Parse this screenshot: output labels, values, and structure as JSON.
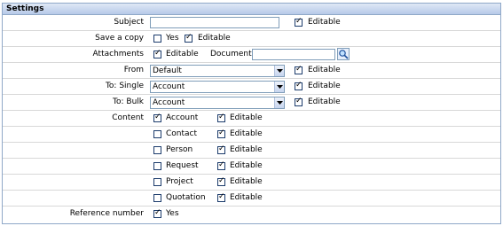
{
  "panel": {
    "title": "Settings"
  },
  "rows": {
    "subject": {
      "label": "Subject",
      "value": "",
      "editable_checked": true,
      "editable_label": "Editable"
    },
    "save_copy": {
      "label": "Save a copy",
      "yes_checked": false,
      "yes_label": "Yes",
      "editable_checked": true,
      "editable_label": "Editable"
    },
    "attachments": {
      "label": "Attachments",
      "editable_checked": true,
      "editable_label": "Editable",
      "document_label": "Document",
      "document_value": ""
    },
    "from": {
      "label": "From",
      "value": "Default",
      "editable_checked": true,
      "editable_label": "Editable"
    },
    "to_single": {
      "label": "To: Single",
      "value": "Account",
      "editable_checked": true,
      "editable_label": "Editable"
    },
    "to_bulk": {
      "label": "To: Bulk",
      "value": "Account",
      "editable_checked": true,
      "editable_label": "Editable"
    },
    "content": {
      "label": "Content",
      "items": [
        {
          "label": "Account",
          "checked": true,
          "editable_checked": true,
          "editable_label": "Editable"
        },
        {
          "label": "Contact",
          "checked": false,
          "editable_checked": true,
          "editable_label": "Editable"
        },
        {
          "label": "Person",
          "checked": false,
          "editable_checked": true,
          "editable_label": "Editable"
        },
        {
          "label": "Request",
          "checked": false,
          "editable_checked": true,
          "editable_label": "Editable"
        },
        {
          "label": "Project",
          "checked": false,
          "editable_checked": true,
          "editable_label": "Editable"
        },
        {
          "label": "Quotation",
          "checked": false,
          "editable_checked": true,
          "editable_label": "Editable"
        }
      ]
    },
    "reference": {
      "label": "Reference number",
      "yes_checked": true,
      "yes_label": "Yes"
    }
  },
  "colors": {
    "header_bg": "#b6c9e8",
    "border": "#8fa8c8",
    "row_divider": "#d8d8d8"
  },
  "icons": {
    "document_search": "magnifier-icon",
    "dropdown": "chevron-down-icon"
  }
}
